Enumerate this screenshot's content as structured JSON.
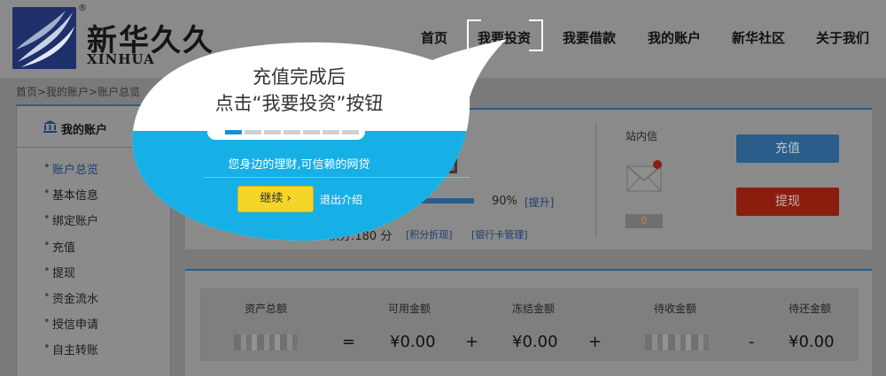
{
  "header": {
    "brand_cn": "新华久久",
    "brand_en": "XINHUA",
    "registered": "®",
    "nav": [
      "首页",
      "我要投资",
      "我要借款",
      "我的账户",
      "新华社区",
      "关于我们"
    ],
    "active_nav": "我要投资"
  },
  "breadcrumb": "首页>我的账户>账户总览",
  "sidebar": {
    "title": "我的账户",
    "items": [
      "账户总览",
      "基本信息",
      "绑定账户",
      "充值",
      "提现",
      "资金流水",
      "授信申请",
      "自主转账"
    ]
  },
  "account": {
    "progress_label": "90%",
    "progress_value": 0.9,
    "progress_link": "[提升]",
    "score_text": "积分:180 分",
    "score_link1": "[积分折现]",
    "score_link2": "[银行卡管理]",
    "message_title": "站内信",
    "message_count": "0",
    "recharge_label": "充值",
    "withdraw_label": "提现"
  },
  "assets": {
    "labels": [
      "资产总额",
      "可用金额",
      "冻结金额",
      "待收金额",
      "待还金额"
    ],
    "available": "¥0.00",
    "frozen": "¥0.00",
    "pending_repay": "¥0.00",
    "ops": [
      "=",
      "+",
      "+",
      "-"
    ]
  },
  "bubble": {
    "title_line1": "充值完成后",
    "title_line2": "点击“我要投资”按钮",
    "slogan": "您身边的理财,可信赖的网贷",
    "continue_label": "继续 ›",
    "exit_label": "退出介绍",
    "progress_segments": 7,
    "progress_done": 1
  },
  "colors": {
    "bubble_blue": "#17b0e6",
    "continue_yellow": "#f5d527",
    "accent_blue": "#2a5d8a",
    "withdraw_red": "#8a1d0d"
  }
}
